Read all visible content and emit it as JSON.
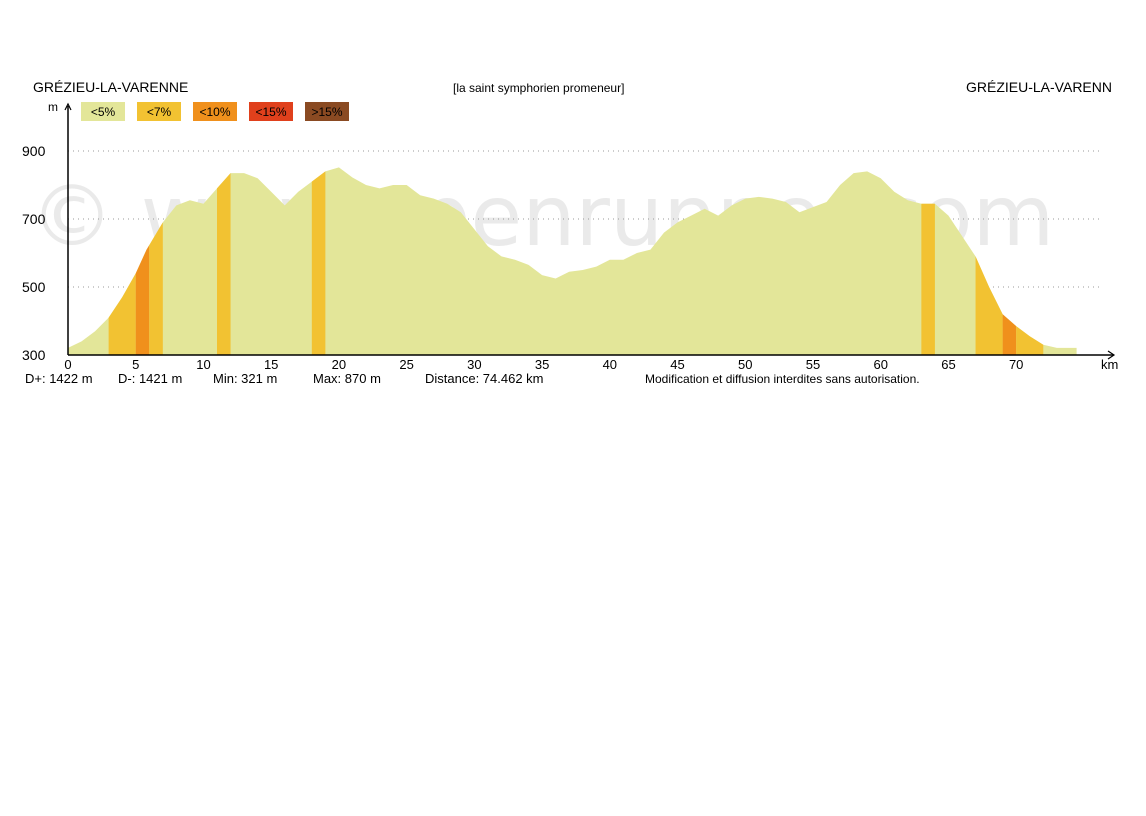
{
  "header": {
    "start_place": "GRÉZIEU-LA-VARENNE",
    "route_name": "[la saint symphorien promeneur]",
    "end_place": "GRÉZIEU-LA-VARENN"
  },
  "stats": {
    "d_plus": "D+: 1422 m",
    "d_minus": "D-: 1421 m",
    "min": "Min: 321 m",
    "max": "Max: 870 m",
    "distance": "Distance: 74.462 km"
  },
  "notice": "Modification et diffusion interdites sans autorisation.",
  "watermark": "© www.openrunner.com",
  "chart_data": {
    "type": "area",
    "xlabel": "km",
    "ylabel": "m",
    "xlim": [
      0,
      77
    ],
    "ylim": [
      300,
      1050
    ],
    "x_ticks": [
      0,
      5,
      10,
      15,
      20,
      25,
      30,
      35,
      40,
      45,
      50,
      55,
      60,
      65,
      70
    ],
    "y_ticks": [
      300,
      500,
      700,
      900
    ],
    "grid": "horizontal-dotted",
    "legend": {
      "placement": "top-left",
      "entries": [
        {
          "label": "<5%",
          "color": "#e3e699"
        },
        {
          "label": "<7%",
          "color": "#f2c232"
        },
        {
          "label": "<10%",
          "color": "#f0901c"
        },
        {
          "label": "<15%",
          "color": "#e0401c"
        },
        {
          "label": ">15%",
          "color": "#8a4a22"
        }
      ]
    },
    "profile": {
      "x": [
        0,
        1,
        2,
        3,
        4,
        5,
        5.8,
        7,
        8,
        9,
        10,
        11,
        12,
        13,
        14,
        15,
        16,
        17,
        18,
        19,
        20,
        21,
        22,
        23,
        24,
        25,
        26,
        27,
        28,
        29,
        30,
        31,
        32,
        33,
        34,
        35,
        36,
        37,
        38,
        39,
        40,
        41,
        42,
        43,
        44,
        45,
        46,
        47,
        48,
        49,
        50,
        51,
        52,
        53,
        54,
        55,
        56,
        57,
        58,
        59,
        60,
        61,
        62,
        63,
        64,
        65,
        66,
        67,
        68,
        69,
        70,
        71,
        72,
        73,
        74,
        74.46
      ],
      "y": [
        321,
        340,
        370,
        410,
        470,
        540,
        610,
        690,
        740,
        755,
        745,
        790,
        835,
        835,
        820,
        780,
        740,
        780,
        810,
        840,
        852,
        822,
        800,
        790,
        800,
        800,
        770,
        760,
        745,
        720,
        670,
        620,
        590,
        580,
        565,
        535,
        525,
        545,
        550,
        560,
        580,
        580,
        600,
        610,
        660,
        690,
        710,
        730,
        710,
        740,
        760,
        765,
        760,
        750,
        720,
        735,
        750,
        800,
        835,
        840,
        820,
        780,
        755,
        745,
        745,
        710,
        650,
        590,
        500,
        420,
        385,
        355,
        330,
        321,
        321,
        321
      ]
    },
    "slope_bands": [
      {
        "from": 3,
        "to": 5,
        "class": "<7%"
      },
      {
        "from": 5,
        "to": 6,
        "class": "<10%"
      },
      {
        "from": 6,
        "to": 7,
        "class": "<7%"
      },
      {
        "from": 11,
        "to": 12,
        "class": "<7%"
      },
      {
        "from": 18,
        "to": 19,
        "class": "<7%"
      },
      {
        "from": 63,
        "to": 64,
        "class": "<7%"
      },
      {
        "from": 67,
        "to": 69,
        "class": "<7%"
      },
      {
        "from": 69,
        "to": 70,
        "class": "<10%"
      },
      {
        "from": 70,
        "to": 72,
        "class": "<7%"
      }
    ]
  }
}
